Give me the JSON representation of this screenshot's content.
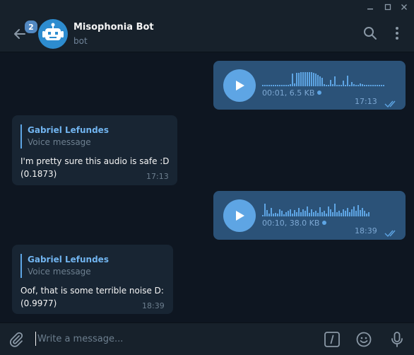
{
  "window": {
    "controls": [
      "minimize",
      "maximize",
      "close"
    ]
  },
  "header": {
    "unread_count": "2",
    "title": "Misophonia Bot",
    "subtitle": "bot",
    "icons": [
      "back-arrow-icon",
      "robot-avatar",
      "search-icon",
      "more-vertical-icon"
    ]
  },
  "messages": [
    {
      "type": "voice",
      "direction": "out",
      "duration_size": "00:01, 6.5 KB",
      "time": "17:13",
      "status": "read",
      "progress": 0
    },
    {
      "type": "text",
      "direction": "in",
      "reply_name": "Gabriel Lefundes",
      "reply_text": "Voice message",
      "line1": "I'm pretty sure this audio is safe :D",
      "line2": "(0.1873)",
      "time": "17:13"
    },
    {
      "type": "voice",
      "direction": "out",
      "duration_size": "00:10, 38.0 KB",
      "time": "18:39",
      "status": "read",
      "progress": 0
    },
    {
      "type": "text",
      "direction": "in",
      "reply_name": "Gabriel Lefundes",
      "reply_text": "Voice message",
      "line1": "Oof, that is some terrible noise D:",
      "line2": "(0.9977)",
      "time": "18:39"
    }
  ],
  "composer": {
    "placeholder": "Write a message...",
    "icons": [
      "attach-icon",
      "bot-command-icon",
      "emoji-icon",
      "microphone-icon"
    ]
  },
  "colors": {
    "accent": "#5ea5e4",
    "outgoing": "#2b5278",
    "incoming": "#182533",
    "background": "#0e1621",
    "panel": "#17212b"
  }
}
